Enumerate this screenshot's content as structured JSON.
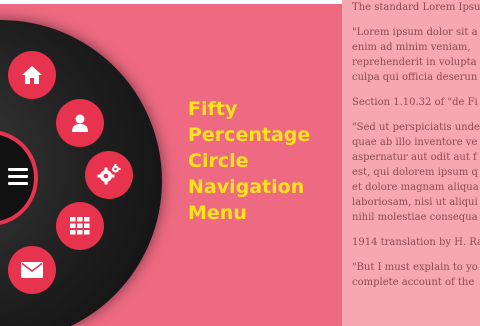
{
  "title": "Fifty\nPercentage\nCircle\nNavigation\nMenu",
  "menu": {
    "toggle": "hamburger-icon",
    "items": [
      {
        "icon": "home-icon"
      },
      {
        "icon": "user-icon"
      },
      {
        "icon": "gears-icon"
      },
      {
        "icon": "grid-icon"
      },
      {
        "icon": "envelope-icon"
      }
    ]
  },
  "colors": {
    "background": "#ee6a82",
    "button": "#e8334f",
    "title": "#ffe21c",
    "panel": "#f6a7b2",
    "panel_text": "#8d4a55"
  },
  "side_text": {
    "p1": [
      "The standard Lorem Ipsu"
    ],
    "p2": [
      "\"Lorem ipsum dolor sit a",
      "enim ad minim veniam,",
      "reprehenderit in volupta",
      "culpa qui officia deserun"
    ],
    "p3": [
      "Section 1.10.32 of \"de Fi"
    ],
    "p4": [
      "\"Sed ut perspiciatis unde",
      "quae ab illo inventore ve",
      "aspernatur aut odit aut f",
      "est, qui dolorem ipsum q",
      "et dolore magnam aliqua",
      "laboriosam, nisi ut aliqui",
      "nihil molestiae consequa"
    ],
    "p5": [
      "1914 translation by H. Ra"
    ],
    "p6": [
      "\"But I must explain to yo",
      "complete account of the"
    ]
  }
}
